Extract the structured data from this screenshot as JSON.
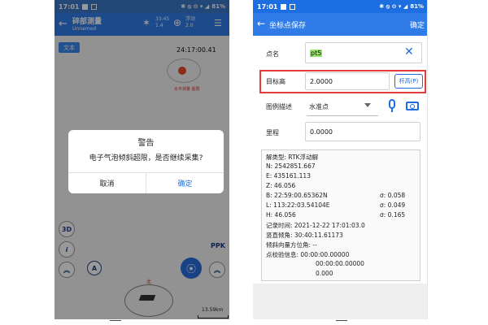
{
  "left": {
    "status": {
      "time": "17:01",
      "icons": "✱ ⦸ ⊝ ▾ ◢",
      "battery": "81%"
    },
    "header": {
      "title": "碎部测量",
      "subtitle": "Unnamed",
      "stat1_top": "33:45",
      "stat1_bottom": "1.4",
      "stat2_top": "浮动",
      "stat2_bottom": "2.0"
    },
    "map": {
      "text_chip": "文本",
      "timer": "24:17:00.41",
      "tilt_note": "水平测量 超限",
      "btn_3d": "3D",
      "btn_info": "i",
      "btn_up": "︽",
      "btn_up2": "︽",
      "ppk": "PPK",
      "compass_north": "北",
      "scale": "13.59km"
    },
    "dialog": {
      "title": "警告",
      "message": "电子气泡倾斜超限，是否继续采集?",
      "cancel": "取消",
      "confirm": "确定"
    }
  },
  "right": {
    "status": {
      "time": "17:01",
      "icons": "✱ ⦸ ⊝ ▾ ◢",
      "battery": "81%"
    },
    "app_bar": {
      "title": "坐标点保存",
      "confirm": "确定"
    },
    "form": {
      "point_name_label": "点名",
      "point_name_value": "pt5",
      "target_height_label": "目标高",
      "target_height_value": "2.0000",
      "pole_height_button": "杆高(P)",
      "desc_label": "图例描述",
      "desc_value": "水准点",
      "mileage_label": "里程",
      "mileage_value": "0.0000"
    },
    "info": [
      "解类型: RTK浮动解",
      "N: 2542851.667",
      "E: 435161.113",
      "Z: 46.056",
      "B: 22:59:00.65362N",
      "L: 113:22:03.54104E",
      "H: 46.056",
      "记录时间: 2021-12-22 17:01:03.0",
      "竖直倾角: 30:40:11.61173",
      "倾斜向量方位角: --",
      "点校验信息: 00:00:00.00000",
      "00:00:00.00000",
      "0.000"
    ],
    "sigma": [
      "σ: 0.058",
      "σ: 0.049",
      "σ: 0.165"
    ]
  }
}
